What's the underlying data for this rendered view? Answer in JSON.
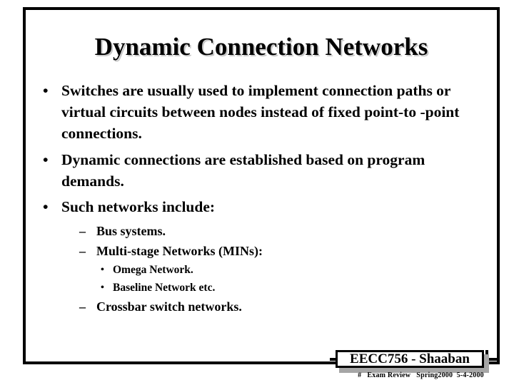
{
  "slide": {
    "title": "Dynamic Connection Networks",
    "background_color": "#ffffff",
    "text_color": "#000000",
    "frame_color": "#000000",
    "title_shadow_color": "#c9c9c9"
  },
  "bullets": {
    "level1_marker": "•",
    "level2_marker": "–",
    "level3_marker": "•",
    "items": [
      {
        "level": 1,
        "text": "Switches are usually used to implement connection paths or virtual circuits between nodes instead of fixed point-to -point connections."
      },
      {
        "level": 1,
        "text": "Dynamic connections are established based on program demands."
      },
      {
        "level": 1,
        "text": "Such networks include:"
      },
      {
        "level": 2,
        "text": "Bus systems."
      },
      {
        "level": 2,
        "text": "Multi-stage Networks (MINs):"
      },
      {
        "level": 3,
        "text": "Omega Network."
      },
      {
        "level": 3,
        "text": "Baseline Network  etc."
      },
      {
        "level": 2,
        "text": "Crossbar switch networks."
      }
    ]
  },
  "footer": {
    "badge_text": "EECC756 - Shaaban",
    "badge_shadow_color": "#a6a6a6",
    "sub_text": "#   Exam Review   Spring2000  5-4-2000"
  }
}
